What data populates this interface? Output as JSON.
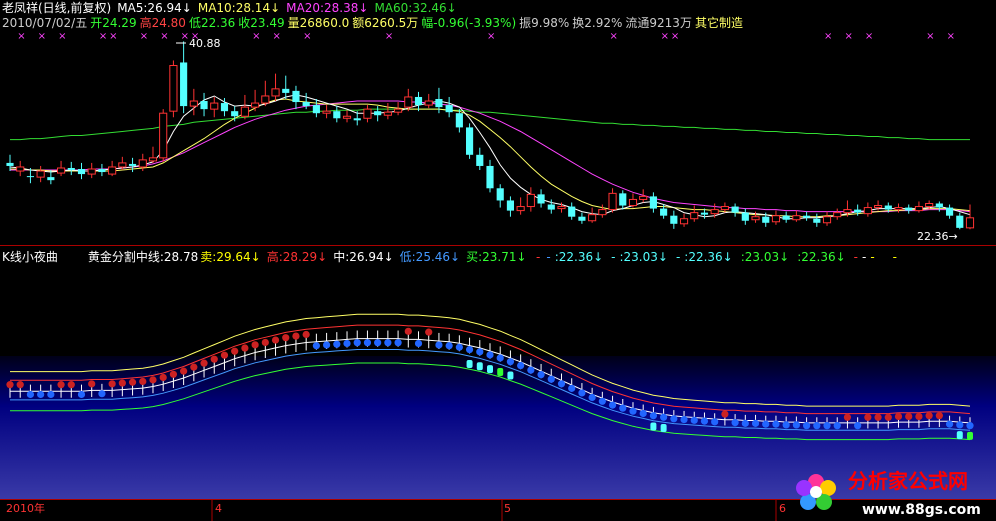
{
  "colors": {
    "up": "#ff3333",
    "down": "#54ffff",
    "ma5": "#ffffff",
    "ma10": "#ffff66",
    "ma20": "#ff44ff",
    "ma60": "#33dd33",
    "gold": "#ffffff",
    "sell": "#ffff00",
    "high": "#ff3333",
    "mid": "#ffffff",
    "low": "#4499ff",
    "buy": "#33ff33"
  },
  "header1": {
    "name": "老凤祥(日线,前复权)",
    "ma5": "MA5:26.94↓",
    "ma10": "MA10:28.14↓",
    "ma20": "MA20:28.38↓",
    "ma60": "MA60:32.46↓"
  },
  "header2": {
    "date": "2010/07/02/五",
    "open": "开24.29",
    "high": "高24.80",
    "low": "低22.36",
    "close": "收23.49",
    "volume": "量26860.0",
    "amount": "额6260.5万",
    "change": "幅-0.96(-3.93%)",
    "amplitude": "振9.98%",
    "turnover": "换2.92%",
    "float": "流通9213万",
    "sector": "其它制造"
  },
  "header3": {
    "name": "K线小夜曲",
    "gold": "黄金分割中线:28.78",
    "sell": "卖:29.64↓",
    "high": "高:28.29↓",
    "mid": "中:26.94↓",
    "low": "低:25.46↓",
    "buy": "买:23.71↓",
    "trail": [
      "-",
      "-",
      ":22.36↓",
      "-",
      ":23.03↓",
      "-",
      ":22.36↓",
      ":23.03↓",
      ":22.36↓",
      "-",
      "-",
      "-",
      "-"
    ]
  },
  "annotations": {
    "max": "40.88",
    "min": "22.36→"
  },
  "axis": {
    "labels": [
      "2010年",
      "4",
      "5",
      "6"
    ]
  },
  "watermark": {
    "cn": "分析家公式网",
    "url": "www.88gs.com"
  },
  "chart_data": {
    "type": "candlestick",
    "price_range": [
      21.5,
      42.0
    ],
    "candles": [
      [
        28.9,
        28.6,
        29.7,
        28.1
      ],
      [
        28.1,
        28.5,
        29.1,
        27.6
      ],
      [
        27.6,
        27.5,
        28.4,
        26.9
      ],
      [
        27.5,
        28.1,
        28.6,
        27.0
      ],
      [
        27.5,
        27.2,
        28.2,
        26.8
      ],
      [
        27.9,
        28.4,
        29.1,
        27.6
      ],
      [
        28.4,
        28.2,
        29.0,
        27.7
      ],
      [
        28.3,
        27.8,
        28.9,
        27.3
      ],
      [
        27.8,
        28.3,
        28.9,
        27.4
      ],
      [
        28.3,
        28.0,
        28.8,
        27.6
      ],
      [
        27.8,
        28.5,
        29.1,
        27.6
      ],
      [
        28.5,
        28.9,
        29.5,
        28.2
      ],
      [
        28.8,
        28.6,
        29.4,
        28.0
      ],
      [
        28.5,
        29.2,
        29.8,
        28.1
      ],
      [
        29.1,
        29.4,
        30.5,
        28.9
      ],
      [
        29.4,
        33.8,
        34.2,
        29.0
      ],
      [
        34.0,
        38.5,
        39.0,
        33.4
      ],
      [
        38.8,
        34.5,
        40.88,
        33.8
      ],
      [
        34.5,
        35.0,
        36.2,
        33.6
      ],
      [
        35.0,
        34.2,
        35.8,
        33.5
      ],
      [
        34.2,
        34.8,
        35.4,
        33.4
      ],
      [
        34.8,
        34.0,
        35.3,
        33.5
      ],
      [
        34.0,
        33.5,
        34.5,
        33.0
      ],
      [
        33.5,
        34.4,
        35.6,
        33.2
      ],
      [
        34.4,
        34.8,
        36.1,
        34.0
      ],
      [
        34.8,
        35.5,
        37.0,
        34.5
      ],
      [
        35.5,
        36.2,
        37.7,
        35.0
      ],
      [
        36.2,
        35.8,
        37.5,
        35.2
      ],
      [
        36.0,
        34.9,
        36.5,
        34.2
      ],
      [
        34.9,
        34.5,
        35.8,
        34.2
      ],
      [
        34.6,
        33.8,
        35.2,
        33.4
      ],
      [
        33.8,
        34.0,
        34.6,
        33.3
      ],
      [
        34.0,
        33.3,
        34.5,
        32.9
      ],
      [
        33.3,
        33.5,
        34.1,
        32.9
      ],
      [
        33.3,
        33.1,
        34.0,
        32.6
      ],
      [
        33.3,
        34.2,
        34.6,
        32.9
      ],
      [
        34.0,
        33.6,
        34.5,
        33.0
      ],
      [
        33.6,
        33.9,
        34.8,
        33.2
      ],
      [
        33.9,
        34.2,
        34.9,
        33.6
      ],
      [
        34.4,
        35.4,
        36.2,
        34.0
      ],
      [
        35.4,
        34.6,
        35.9,
        34.0
      ],
      [
        34.6,
        35.0,
        35.7,
        34.3
      ],
      [
        35.2,
        34.4,
        36.3,
        33.8
      ],
      [
        34.6,
        33.9,
        35.4,
        33.4
      ],
      [
        33.8,
        32.4,
        34.2,
        31.9
      ],
      [
        32.4,
        29.7,
        32.8,
        29.3
      ],
      [
        29.7,
        28.6,
        30.4,
        28.2
      ],
      [
        28.6,
        26.4,
        29.2,
        26.0
      ],
      [
        26.4,
        25.2,
        26.8,
        24.5
      ],
      [
        25.2,
        24.2,
        25.6,
        23.6
      ],
      [
        24.2,
        24.6,
        25.5,
        23.8
      ],
      [
        24.6,
        25.8,
        26.5,
        24.1
      ],
      [
        25.8,
        24.9,
        26.3,
        24.5
      ],
      [
        24.8,
        24.3,
        25.3,
        23.9
      ],
      [
        24.4,
        24.6,
        25.0,
        24.0
      ],
      [
        24.6,
        23.6,
        25.0,
        23.3
      ],
      [
        23.6,
        23.2,
        24.0,
        22.9
      ],
      [
        23.2,
        23.8,
        24.5,
        23.0
      ],
      [
        23.8,
        24.3,
        24.8,
        23.5
      ],
      [
        24.3,
        25.9,
        26.4,
        24.0
      ],
      [
        25.9,
        24.7,
        26.2,
        24.3
      ],
      [
        24.7,
        25.3,
        25.9,
        24.5
      ],
      [
        25.3,
        25.6,
        26.3,
        25.0
      ],
      [
        25.6,
        24.4,
        26.0,
        24.0
      ],
      [
        24.4,
        23.7,
        24.8,
        23.4
      ],
      [
        23.7,
        22.9,
        24.2,
        22.4
      ],
      [
        22.9,
        23.4,
        23.9,
        22.6
      ],
      [
        23.4,
        24.0,
        24.7,
        23.1
      ],
      [
        24.0,
        23.8,
        24.4,
        23.4
      ],
      [
        23.9,
        24.3,
        24.9,
        23.5
      ],
      [
        24.3,
        24.6,
        25.0,
        24.0
      ],
      [
        24.6,
        24.0,
        24.9,
        23.6
      ],
      [
        24.0,
        23.2,
        24.4,
        22.8
      ],
      [
        23.3,
        23.6,
        24.1,
        23.0
      ],
      [
        23.6,
        23.0,
        24.0,
        22.6
      ],
      [
        23.1,
        23.7,
        24.2,
        22.8
      ],
      [
        23.7,
        23.3,
        24.1,
        23.0
      ],
      [
        23.3,
        23.7,
        24.2,
        23.1
      ],
      [
        23.7,
        23.5,
        24.1,
        23.2
      ],
      [
        23.4,
        23.0,
        23.9,
        22.6
      ],
      [
        23.0,
        23.6,
        24.1,
        22.7
      ],
      [
        23.6,
        24.0,
        24.4,
        23.3
      ],
      [
        24.0,
        24.3,
        25.2,
        23.6
      ],
      [
        24.3,
        24.0,
        24.8,
        23.7
      ],
      [
        23.9,
        24.5,
        25.0,
        23.6
      ],
      [
        24.5,
        24.7,
        25.2,
        24.2
      ],
      [
        24.7,
        24.3,
        25.0,
        24.0
      ],
      [
        24.3,
        24.5,
        24.9,
        24.0
      ],
      [
        24.5,
        24.2,
        24.8,
        23.9
      ],
      [
        24.2,
        24.6,
        25.1,
        24.0
      ],
      [
        24.6,
        24.9,
        25.2,
        24.3
      ],
      [
        24.9,
        24.5,
        25.1,
        24.1
      ],
      [
        24.5,
        23.7,
        24.8,
        23.4
      ],
      [
        23.7,
        22.5,
        24.0,
        22.36
      ],
      [
        22.5,
        23.49,
        24.8,
        22.36
      ]
    ],
    "ma5": [
      28.5,
      28.4,
      28.2,
      28.1,
      28.0,
      28.1,
      28.2,
      28.1,
      28.1,
      28.2,
      28.3,
      28.4,
      28.5,
      28.7,
      29.0,
      30.1,
      32.0,
      33.5,
      34.3,
      35.1,
      35.5,
      34.9,
      34.5,
      34.6,
      34.5,
      34.7,
      35.0,
      35.4,
      35.6,
      35.4,
      35.1,
      34.8,
      34.5,
      34.2,
      33.8,
      33.8,
      33.8,
      33.9,
      34.0,
      34.3,
      34.6,
      34.8,
      35.0,
      34.8,
      34.4,
      33.3,
      31.9,
      30.4,
      28.7,
      27.4,
      26.5,
      25.8,
      25.3,
      25.0,
      24.8,
      24.5,
      24.1,
      23.9,
      23.8,
      24.2,
      24.4,
      24.7,
      25.0,
      25.1,
      24.8,
      24.5,
      24.0,
      23.8,
      23.6,
      23.7,
      24.0,
      24.1,
      24.0,
      23.9,
      23.8,
      23.6,
      23.4,
      23.4,
      23.5,
      23.5,
      23.6,
      23.7,
      23.9,
      24.1,
      24.2,
      24.4,
      24.4,
      24.4,
      24.4,
      24.4,
      24.5,
      24.6,
      24.4,
      24.1,
      23.8
    ],
    "ma10": [
      28.3,
      28.3,
      28.2,
      28.2,
      28.1,
      28.1,
      28.1,
      28.1,
      28.1,
      28.1,
      28.1,
      28.2,
      28.3,
      28.4,
      28.5,
      28.9,
      29.5,
      30.1,
      30.7,
      31.3,
      32.0,
      32.7,
      33.3,
      33.8,
      34.3,
      34.8,
      35.1,
      35.2,
      35.0,
      34.9,
      34.8,
      34.7,
      34.7,
      34.7,
      34.7,
      34.7,
      34.6,
      34.4,
      34.3,
      34.2,
      34.2,
      34.2,
      34.2,
      34.1,
      34.0,
      33.6,
      33.0,
      32.2,
      31.4,
      30.5,
      29.5,
      28.5,
      27.6,
      26.8,
      26.2,
      25.6,
      25.1,
      24.7,
      24.5,
      24.3,
      24.4,
      24.4,
      24.5,
      24.6,
      24.6,
      24.5,
      24.4,
      24.3,
      24.3,
      24.2,
      24.1,
      24.0,
      23.9,
      23.8,
      23.8,
      23.7,
      23.7,
      23.6,
      23.6,
      23.6,
      23.7,
      23.7,
      23.8,
      23.9,
      24.0,
      24.1,
      24.2,
      24.2,
      24.3,
      24.3,
      24.4,
      24.4,
      24.4,
      24.3,
      24.2
    ],
    "ma20": [
      28.2,
      28.2,
      28.2,
      28.2,
      28.2,
      28.2,
      28.2,
      28.2,
      28.3,
      28.3,
      28.3,
      28.4,
      28.5,
      28.6,
      28.8,
      29.1,
      29.5,
      29.9,
      30.4,
      30.9,
      31.4,
      31.9,
      32.4,
      32.8,
      33.2,
      33.5,
      33.8,
      34.1,
      34.3,
      34.5,
      34.6,
      34.7,
      34.8,
      34.9,
      35.0,
      35.0,
      35.0,
      35.0,
      35.0,
      34.9,
      34.9,
      34.8,
      34.7,
      34.6,
      34.4,
      34.1,
      33.8,
      33.4,
      33.0,
      32.5,
      32.0,
      31.4,
      30.8,
      30.2,
      29.6,
      29.0,
      28.4,
      27.8,
      27.3,
      26.8,
      26.4,
      26.0,
      25.7,
      25.4,
      25.2,
      25.0,
      24.9,
      24.8,
      24.7,
      24.6,
      24.5,
      24.5,
      24.4,
      24.4,
      24.3,
      24.3,
      24.2,
      24.2,
      24.1,
      24.1,
      24.1,
      24.1,
      24.1,
      24.1,
      24.1,
      24.1,
      24.1,
      24.2,
      24.2,
      24.2,
      24.3,
      24.3,
      24.3,
      24.2,
      24.1
    ],
    "ma60": [
      31.2,
      31.2,
      31.3,
      31.3,
      31.4,
      31.5,
      31.6,
      31.6,
      31.7,
      31.8,
      31.9,
      32.0,
      32.1,
      32.2,
      32.3,
      32.5,
      32.6,
      32.7,
      32.9,
      33.0,
      33.1,
      33.2,
      33.3,
      33.4,
      33.5,
      33.6,
      33.7,
      33.8,
      33.9,
      33.9,
      34.0,
      34.0,
      34.1,
      34.1,
      34.1,
      34.2,
      34.2,
      34.2,
      34.2,
      34.2,
      34.2,
      34.2,
      34.2,
      34.1,
      34.1,
      34.0,
      33.9,
      33.9,
      33.8,
      33.7,
      33.6,
      33.5,
      33.4,
      33.3,
      33.2,
      33.1,
      33.0,
      32.9,
      32.8,
      32.8,
      32.7,
      32.7,
      32.6,
      32.6,
      32.5,
      32.5,
      32.4,
      32.4,
      32.3,
      32.3,
      32.2,
      32.2,
      32.1,
      32.1,
      32.0,
      32.0,
      31.9,
      31.9,
      31.8,
      31.8,
      31.7,
      31.7,
      31.6,
      31.6,
      31.5,
      31.5,
      31.4,
      31.4,
      31.3,
      31.3,
      31.2,
      31.2,
      31.2,
      31.2,
      31.2
    ],
    "cross_marks_idx": [
      1,
      3,
      5,
      9,
      10,
      13,
      15,
      17,
      18,
      24,
      26,
      29,
      37,
      47,
      59,
      64,
      65,
      80,
      82,
      84,
      90,
      92
    ]
  }
}
